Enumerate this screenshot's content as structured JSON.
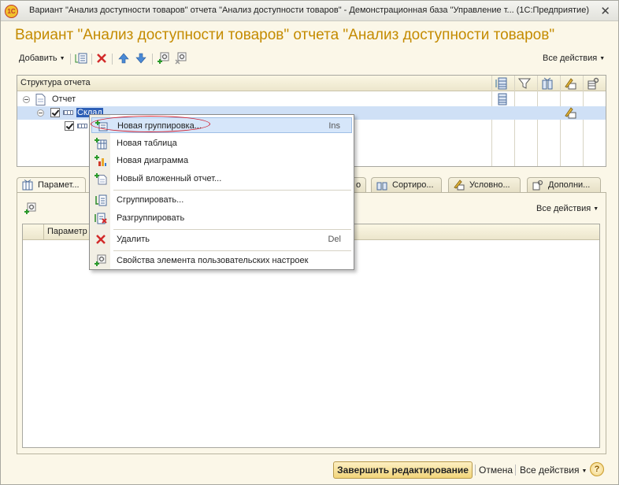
{
  "window": {
    "logo": "1С",
    "title": "Вариант \"Анализ доступности товаров\" отчета \"Анализ доступности товаров\" - Демонстрационная база \"Управление т...   (1С:Предприятие)",
    "close": "✕"
  },
  "form": {
    "heading": "Вариант \"Анализ доступности товаров\" отчета \"Анализ доступности товаров\""
  },
  "toolbar": {
    "add_label": "Добавить",
    "all_actions": "Все действия"
  },
  "structure": {
    "header": "Структура отчета",
    "rows": [
      {
        "label": "Отчет"
      },
      {
        "label": "Склад"
      },
      {
        "label": ""
      }
    ]
  },
  "tabs": [
    {
      "label": "Парамет..."
    },
    {
      "label": "о"
    },
    {
      "label": "Сортиро..."
    },
    {
      "label": "Условно..."
    },
    {
      "label": "Дополни..."
    }
  ],
  "params": {
    "all_actions": "Все действия",
    "column_header": "Параметр"
  },
  "context_menu": {
    "items": [
      {
        "label": "Новая группировка...",
        "shortcut": "Ins",
        "icon": "new-group-icon"
      },
      {
        "label": "Новая таблица",
        "shortcut": "",
        "icon": "new-table-icon"
      },
      {
        "label": "Новая диаграмма",
        "shortcut": "",
        "icon": "new-chart-icon"
      },
      {
        "label": "Новый вложенный отчет...",
        "shortcut": "",
        "icon": "new-nested-report-icon"
      },
      {
        "label": "Сгруппировать...",
        "shortcut": "",
        "icon": "group-icon"
      },
      {
        "label": "Разгруппировать",
        "shortcut": "",
        "icon": "ungroup-icon"
      },
      {
        "label": "Удалить",
        "shortcut": "Del",
        "icon": "delete-icon"
      },
      {
        "label": "Свойства элемента пользовательских настроек",
        "shortcut": "",
        "icon": "properties-icon"
      }
    ]
  },
  "footer": {
    "finish": "Завершить редактирование",
    "cancel": "Отмена",
    "all_actions": "Все действия",
    "help": "?"
  },
  "colors": {
    "title_accent": "#c48b00",
    "selection": "#2d5fb6",
    "highlight_ellipse": "#d21e2e"
  }
}
